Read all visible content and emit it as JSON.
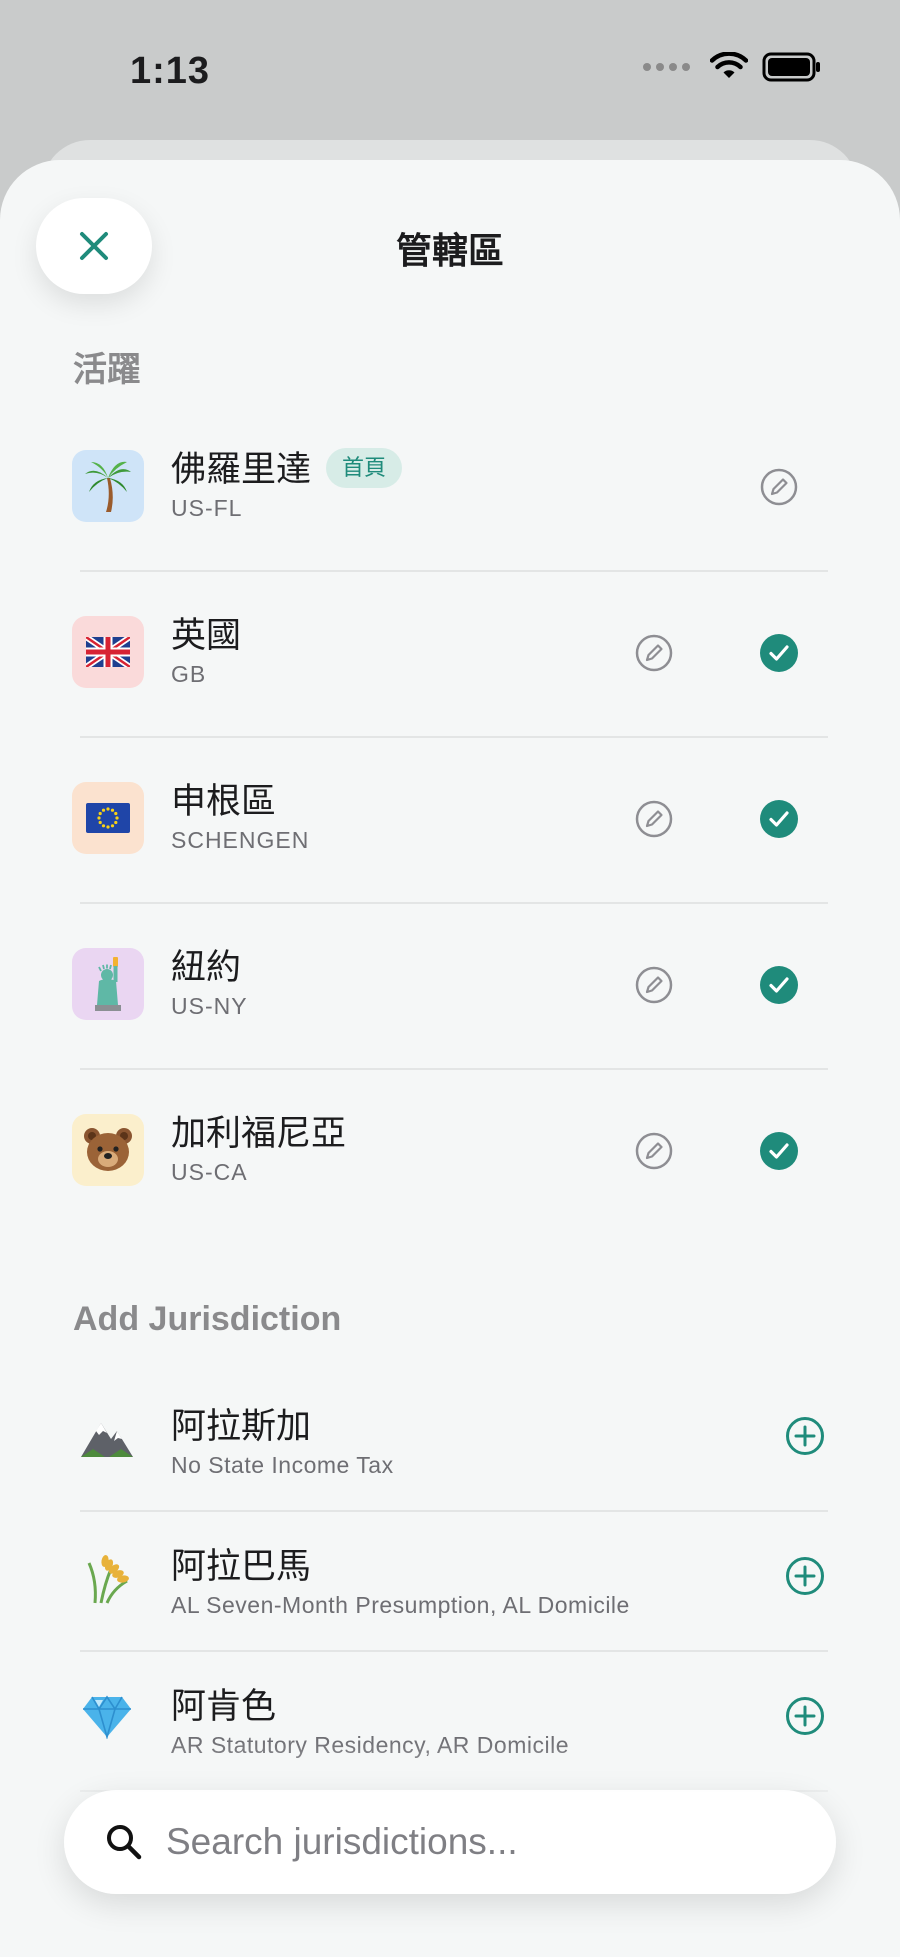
{
  "status_bar": {
    "time": "1:13"
  },
  "header": {
    "title": "管轄區",
    "close_icon": "close-icon"
  },
  "active_section": {
    "title": "活躍",
    "items": [
      {
        "name": "佛羅里達",
        "code": "US-FL",
        "badge": "首頁",
        "icon": "palm-tree-icon",
        "icon_bg": "#cfe4f8",
        "checked": false
      },
      {
        "name": "英國",
        "code": "GB",
        "icon": "uk-flag-icon",
        "icon_bg": "#fadada",
        "checked": true
      },
      {
        "name": "申根區",
        "code": "SCHENGEN",
        "icon": "eu-flag-icon",
        "icon_bg": "#fbe2cf",
        "checked": true
      },
      {
        "name": "紐約",
        "code": "US-NY",
        "icon": "statue-of-liberty-icon",
        "icon_bg": "#ead6f2",
        "checked": true
      },
      {
        "name": "加利福尼亞",
        "code": "US-CA",
        "icon": "bear-icon",
        "icon_bg": "#fbefcc",
        "checked": true
      }
    ]
  },
  "add_section": {
    "title": "Add Jurisdiction",
    "items": [
      {
        "name": "阿拉斯加",
        "desc": "No State Income Tax",
        "icon": "mountain-icon"
      },
      {
        "name": "阿拉巴馬",
        "desc": "AL Seven-Month Presumption, AL Domicile",
        "icon": "wheat-icon"
      },
      {
        "name": "阿肯色",
        "desc": "AR Statutory Residency, AR Domicile",
        "icon": "diamond-icon"
      }
    ]
  },
  "search": {
    "placeholder": "Search jurisdictions..."
  },
  "colors": {
    "accent": "#1f8b7b",
    "background": "#f5f7f7"
  }
}
